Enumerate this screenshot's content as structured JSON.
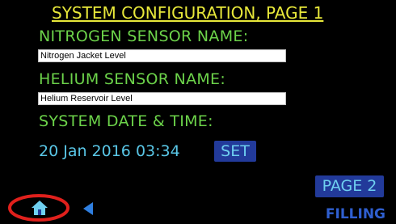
{
  "header": {
    "title": "SYSTEM CONFIGURATION, PAGE 1"
  },
  "nitrogen": {
    "label": "NITROGEN SENSOR NAME:",
    "value": "Nitrogen Jacket Level"
  },
  "helium": {
    "label": "HELIUM SENSOR NAME:",
    "value": "Helium Reservoir Level"
  },
  "datetime": {
    "label": "SYSTEM DATE & TIME:",
    "value": "20 Jan 2016 03:34",
    "set_label": "SET"
  },
  "footer": {
    "page2_label": "PAGE 2",
    "status": "FILLING",
    "home_icon": "home-icon",
    "back_icon": "back-arrow-icon"
  },
  "colors": {
    "background": "#000000",
    "title": "#e8e83a",
    "label": "#6cd34a",
    "datetime": "#59c6e6",
    "button_bg": "#223a9a",
    "button_text": "#6fd0f0",
    "status": "#2f5fd0",
    "highlight_circle": "#e0201c"
  }
}
